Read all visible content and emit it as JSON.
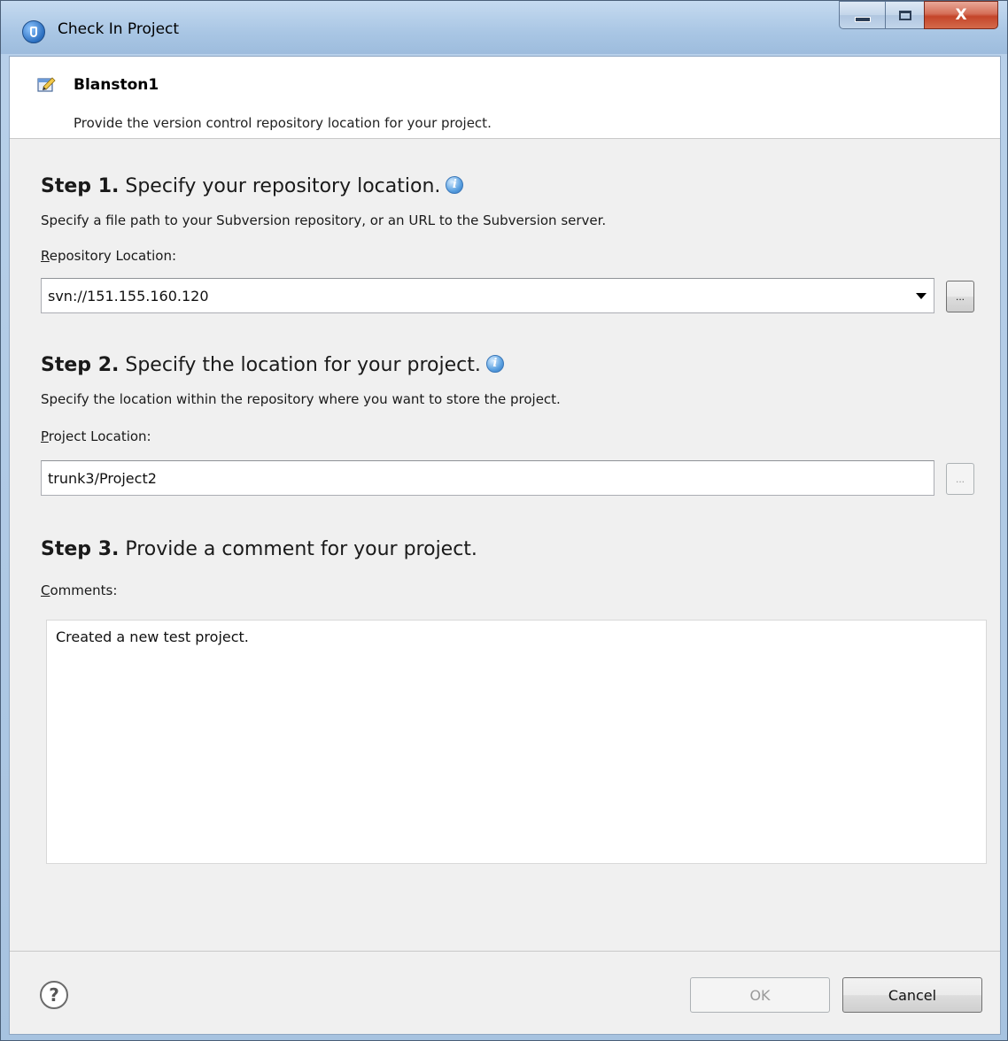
{
  "window": {
    "title": "Check In Project",
    "controls": {
      "minimize": "minimize",
      "maximize": "maximize",
      "close": "X"
    }
  },
  "header": {
    "title": "Blanston1",
    "description": "Provide the version control repository location for your project."
  },
  "step1": {
    "number": "Step 1.",
    "heading": "Specify your repository location.",
    "description": "Specify a file path to your Subversion repository, or an URL to the Subversion server.",
    "label_mnemonic": "R",
    "label_rest": "epository Location:",
    "value": "svn://151.155.160.120",
    "browse": "..."
  },
  "step2": {
    "number": "Step 2.",
    "heading": "Specify the location for your project.",
    "description": "Specify the location within the repository where you want to store the project.",
    "label_mnemonic": "P",
    "label_rest": "roject Location:",
    "value": "trunk3/Project2",
    "browse": "..."
  },
  "step3": {
    "number": "Step 3.",
    "heading": "Provide a comment for your project.",
    "label_mnemonic": "C",
    "label_rest": "omments:",
    "value": "Created a new test project."
  },
  "footer": {
    "help": "?",
    "ok": "OK",
    "cancel": "Cancel"
  },
  "icons": {
    "app": "app-logo-icon",
    "header": "project-wizard-icon",
    "info": "info-icon",
    "help": "help-icon",
    "dropdown": "chevron-down-icon"
  }
}
